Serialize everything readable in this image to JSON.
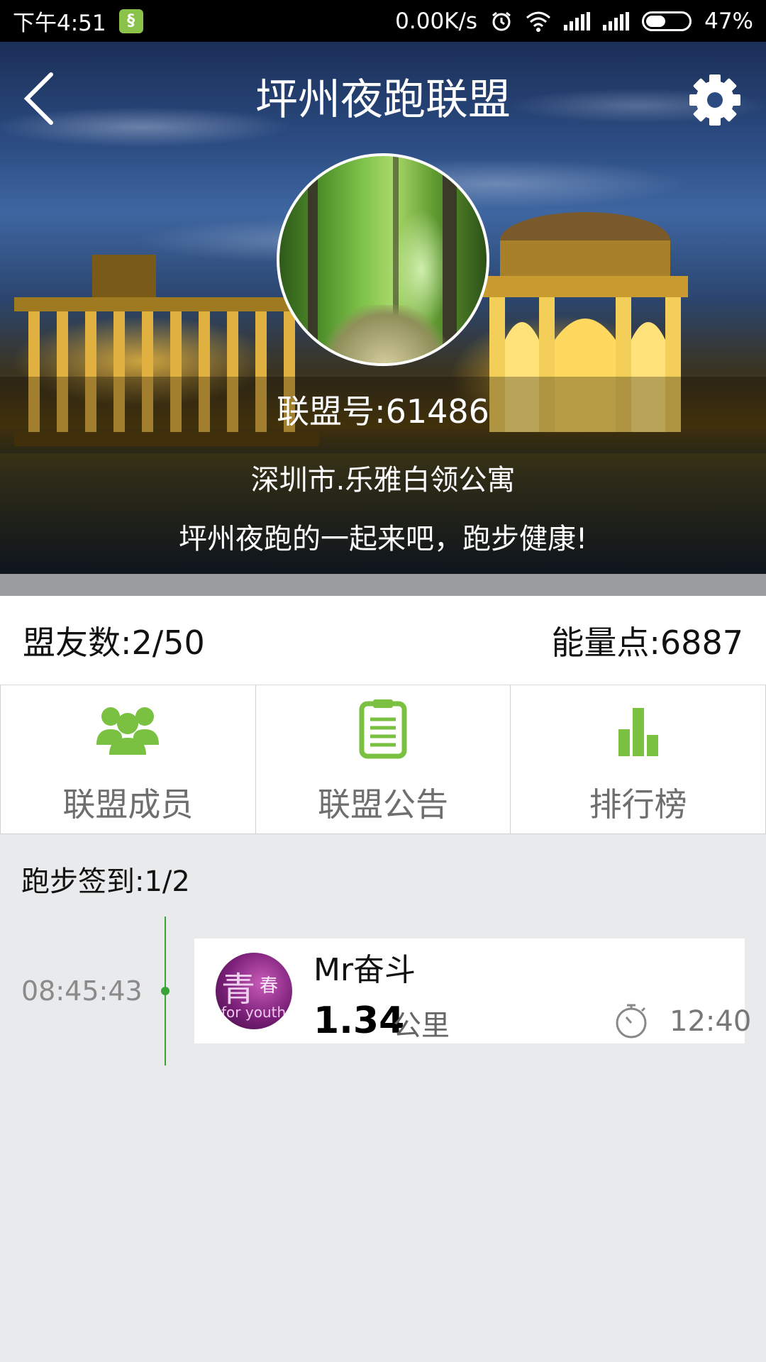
{
  "status_bar": {
    "time": "下午4:51",
    "network_speed": "0.00K/s",
    "battery_percent": "47%",
    "battery_level": 0.47
  },
  "header": {
    "title": "坪州夜跑联盟",
    "back_icon": "chevron-left-icon",
    "settings_icon": "gear-icon"
  },
  "league": {
    "id_text": "联盟号:61486",
    "address": "深圳市.乐雅白领公寓",
    "slogan": "坪州夜跑的一起来吧，跑步健康!"
  },
  "stats": {
    "members": "盟友数:2/50",
    "energy": "能量点:6887"
  },
  "menu": [
    {
      "label": "联盟成员",
      "icon": "members-icon"
    },
    {
      "label": "联盟公告",
      "icon": "announcement-icon"
    },
    {
      "label": "排行榜",
      "icon": "leaderboard-icon"
    }
  ],
  "checkin": {
    "title": "跑步签到:1/2",
    "records": [
      {
        "time": "08:45:43",
        "avatar_text_big": "青",
        "avatar_text_small": "春",
        "avatar_text_sub": "for youth",
        "name": "Mr奋斗",
        "distance": "1.34",
        "distance_unit": "公里",
        "duration": "12:40"
      }
    ]
  },
  "colors": {
    "accent_green": "#7ac142",
    "timeline_green": "#3aa335",
    "menu_label": "#6e6e6e"
  }
}
